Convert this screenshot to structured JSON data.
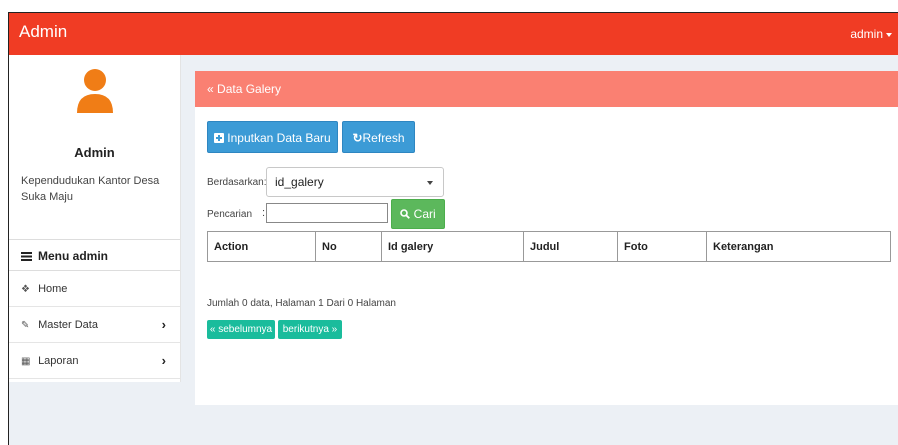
{
  "app": {
    "title": "Admin",
    "user_label": "admin"
  },
  "sidebar": {
    "user_name": "Admin",
    "user_description": "Kependudukan Kantor Desa Suka Maju",
    "menu_header": "Menu admin",
    "items": [
      {
        "label": "Home",
        "icon": "home-icon"
      },
      {
        "label": "Master Data",
        "icon": "edit-icon"
      },
      {
        "label": "Laporan",
        "icon": "calendar-icon"
      }
    ]
  },
  "main": {
    "header": "Data Galery",
    "add_button": "Inputkan Data Baru",
    "refresh_button": "Refresh",
    "filter_label": "Berdasarkan:",
    "filter_value": "id_galery",
    "search_label": "Pencarian",
    "search_colon": ":",
    "search_value": "",
    "search_button": "Cari",
    "table": {
      "columns": [
        "Action",
        "No",
        "Id galery",
        "Judul",
        "Foto",
        "Keterangan"
      ],
      "rows": []
    },
    "summary": "Jumlah 0 data, Halaman 1 Dari 0 Halaman",
    "prev_button": "« sebelumnya",
    "next_button": "berikutnya »"
  },
  "colors": {
    "topbar": "#f03c24",
    "box_header": "#fa8072",
    "primary_button": "#3c9bd6",
    "search_button": "#5cb85c",
    "pagination_button": "#1abc9c",
    "avatar": "#f07d16"
  }
}
